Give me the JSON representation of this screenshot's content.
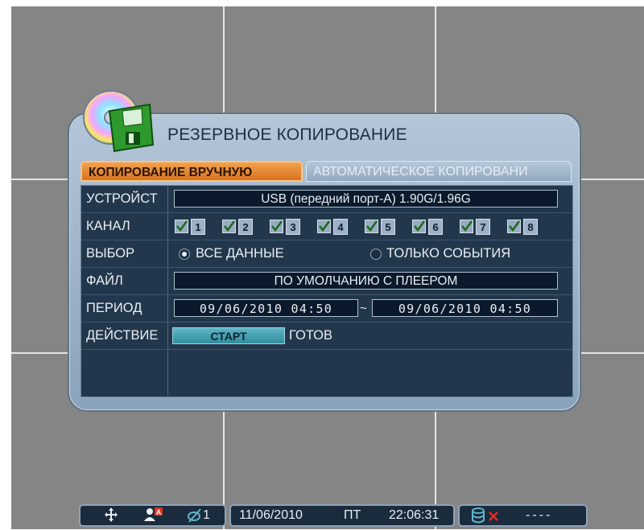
{
  "dialog": {
    "title": "РЕЗЕРВНОЕ КОПИРОВАНИЕ",
    "tabs": [
      {
        "label": "КОПИРОВАНИЕ ВРУЧНУЮ",
        "active": true
      },
      {
        "label": "АВТОМАТИЧЕСКОЕ КОПИРОВАНИ",
        "active": false
      }
    ]
  },
  "form": {
    "device": {
      "label": "УСТРОЙСТ",
      "value": "USB (передний порт-А) 1.90G/1.96G"
    },
    "channel": {
      "label": "КАНАЛ",
      "items": [
        {
          "number": "1",
          "checked": true
        },
        {
          "number": "2",
          "checked": true
        },
        {
          "number": "3",
          "checked": true
        },
        {
          "number": "4",
          "checked": true
        },
        {
          "number": "5",
          "checked": true
        },
        {
          "number": "6",
          "checked": true
        },
        {
          "number": "7",
          "checked": true
        },
        {
          "number": "8",
          "checked": true
        }
      ]
    },
    "selection": {
      "label": "ВЫБОР",
      "options": [
        {
          "label": "ВСЕ ДАННЫЕ",
          "selected": true
        },
        {
          "label": "ТОЛЬКО СОБЫТИЯ",
          "selected": false
        }
      ]
    },
    "file": {
      "label": "ФАЙЛ",
      "value": "ПО УМОЛЧАНИЮ С ПЛЕЕРОМ"
    },
    "period": {
      "label": "ПЕРИОД",
      "from": "09/06/2010 04:50",
      "separator": "~",
      "to": "09/06/2010 04:50"
    },
    "action": {
      "label": "ДЕЙСТВИЕ",
      "button": "СТАРТ",
      "status": "ГОТОВ"
    }
  },
  "statusbar": {
    "icons": [
      "ptz-move-icon",
      "user-icon",
      "no-signal-icon",
      "storage-icon",
      "error-x-icon"
    ],
    "camera_number": "1",
    "date": "11/06/2010",
    "weekday": "ПТ",
    "time": "22:06:31",
    "disk_status": "----"
  },
  "colors": {
    "active_tab": "#e0812c",
    "panel": "#22374c",
    "button": "#3fa1b3",
    "accent_red": "#e0301e"
  }
}
